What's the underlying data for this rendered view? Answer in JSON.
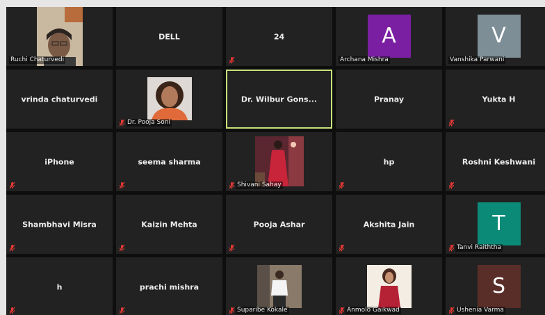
{
  "tiles": [
    {
      "name": "Ruchi Chaturvedi",
      "kind": "photo",
      "photo": "woman-elderly-glasses",
      "muted": false
    },
    {
      "name": "DELL",
      "kind": "text",
      "muted": false
    },
    {
      "name": "24",
      "kind": "text",
      "muted": true
    },
    {
      "name": "Archana Mishra",
      "kind": "avatar",
      "letter": "A",
      "color": "#7b1fa2",
      "muted": false
    },
    {
      "name": "Vanshika Parwani",
      "kind": "avatar",
      "letter": "V",
      "color": "#7d8e96",
      "muted": false
    },
    {
      "name": "vrinda chaturvedi",
      "kind": "text",
      "muted": false
    },
    {
      "name": "Dr. Pooja Soni",
      "kind": "photo",
      "photo": "woman-portrait",
      "muted": true
    },
    {
      "name": "Dr. Wilbur Gons...",
      "kind": "text",
      "muted": false,
      "active": true
    },
    {
      "name": "Pranay",
      "kind": "text",
      "muted": false
    },
    {
      "name": "Yukta H",
      "kind": "text",
      "muted": true
    },
    {
      "name": "iPhone",
      "kind": "text",
      "muted": true
    },
    {
      "name": "seema sharma",
      "kind": "text",
      "muted": true
    },
    {
      "name": "Shivani Sahay",
      "kind": "photo",
      "photo": "woman-red-saree",
      "muted": true
    },
    {
      "name": "hp",
      "kind": "text",
      "muted": true
    },
    {
      "name": "Roshni Keshwani",
      "kind": "text",
      "muted": true
    },
    {
      "name": "Shambhavi Misra",
      "kind": "text",
      "muted": true
    },
    {
      "name": "Kaizin Mehta",
      "kind": "text",
      "muted": true
    },
    {
      "name": "Pooja Ashar",
      "kind": "text",
      "muted": true
    },
    {
      "name": "Akshita Jain",
      "kind": "text",
      "muted": true
    },
    {
      "name": "Tanvi Raiththa",
      "kind": "avatar",
      "letter": "T",
      "color": "#0b8a78",
      "muted": true
    },
    {
      "name": "h",
      "kind": "text",
      "muted": true
    },
    {
      "name": "prachi mishra",
      "kind": "text",
      "muted": true
    },
    {
      "name": "Suparibe Kokale",
      "kind": "photo",
      "photo": "man-white-shirt",
      "muted": true
    },
    {
      "name": "Anmolo Gaikwad",
      "kind": "photo",
      "photo": "woman-red-dress",
      "muted": true
    },
    {
      "name": "Ushenia Varma",
      "kind": "avatar",
      "letter": "S",
      "color": "#5a2e28",
      "muted": true
    }
  ],
  "colors": {
    "mic_muted": "#e53935",
    "active_border": "#c9e27a"
  }
}
